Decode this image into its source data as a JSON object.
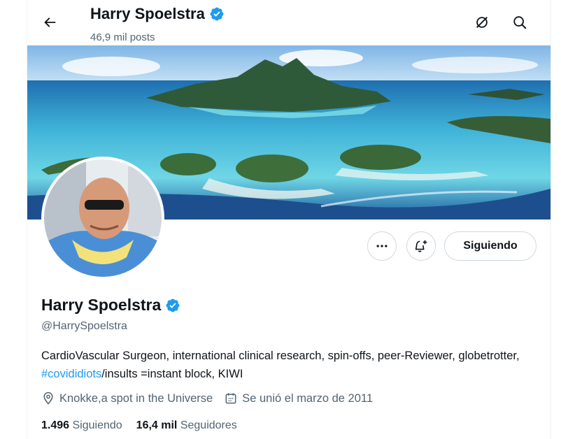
{
  "header": {
    "name": "Harry Spoelstra",
    "posts": "46,9 mil posts"
  },
  "icons": {
    "back": "arrow-left-icon",
    "verified": "verified-badge-icon",
    "grok": "grok-icon",
    "search": "search-icon",
    "more": "more-icon",
    "notify": "bell-plus-icon",
    "location": "location-pin-icon",
    "calendar": "calendar-icon"
  },
  "colors": {
    "accent": "#1d9bf0",
    "text": "#0f1419",
    "secondary": "#536471",
    "border": "#cfd9de"
  },
  "profile": {
    "name": "Harry Spoelstra",
    "handle": "@HarrySpoelstra",
    "bio_part1": "CardioVascular Surgeon, international clinical research, spin-offs, peer-Reviewer, globetrotter, ",
    "bio_link": "#covididiots",
    "bio_part2": "/insults =instant block, KIWI",
    "location": "Knokke,a spot in the Universe",
    "joined": "Se unió el marzo de 2011",
    "following_count": "1.496",
    "following_label": "Siguiendo",
    "followers_count": "16,4 mil",
    "followers_label": "Seguidores"
  },
  "actions": {
    "follow_label": "Siguiendo"
  }
}
